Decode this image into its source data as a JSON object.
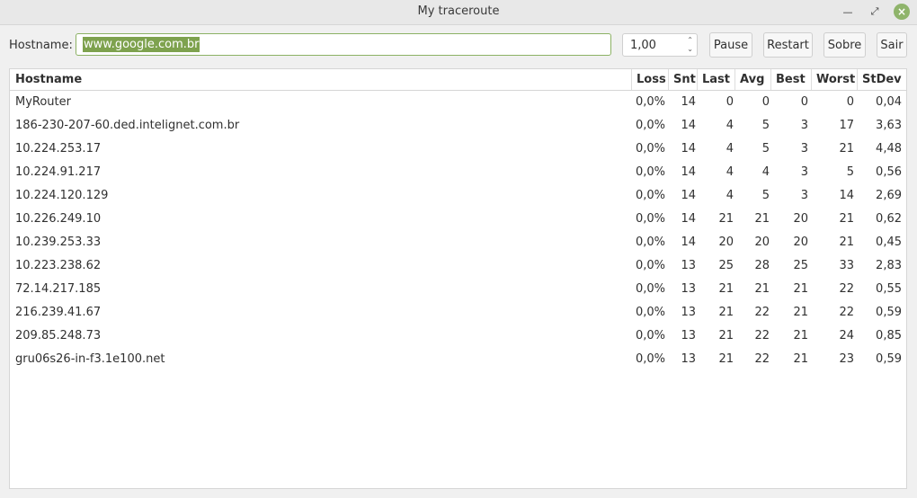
{
  "window": {
    "title": "My traceroute"
  },
  "toolbar": {
    "hostname_label": "Hostname:",
    "hostname_value": "www.google.com.br",
    "interval_value": "1,00",
    "pause_label": "Pause",
    "restart_label": "Restart",
    "sobre_label": "Sobre",
    "sair_label": "Sair"
  },
  "table": {
    "columns": [
      "Hostname",
      "Loss",
      "Snt",
      "Last",
      "Avg",
      "Best",
      "Worst",
      "StDev"
    ],
    "rows": [
      {
        "host": "MyRouter",
        "loss": "0,0%",
        "snt": "14",
        "last": "0",
        "avg": "0",
        "best": "0",
        "worst": "0",
        "stdev": "0,04"
      },
      {
        "host": "186-230-207-60.ded.intelignet.com.br",
        "loss": "0,0%",
        "snt": "14",
        "last": "4",
        "avg": "5",
        "best": "3",
        "worst": "17",
        "stdev": "3,63"
      },
      {
        "host": "10.224.253.17",
        "loss": "0,0%",
        "snt": "14",
        "last": "4",
        "avg": "5",
        "best": "3",
        "worst": "21",
        "stdev": "4,48"
      },
      {
        "host": "10.224.91.217",
        "loss": "0,0%",
        "snt": "14",
        "last": "4",
        "avg": "4",
        "best": "3",
        "worst": "5",
        "stdev": "0,56"
      },
      {
        "host": "10.224.120.129",
        "loss": "0,0%",
        "snt": "14",
        "last": "4",
        "avg": "5",
        "best": "3",
        "worst": "14",
        "stdev": "2,69"
      },
      {
        "host": "10.226.249.10",
        "loss": "0,0%",
        "snt": "14",
        "last": "21",
        "avg": "21",
        "best": "20",
        "worst": "21",
        "stdev": "0,62"
      },
      {
        "host": "10.239.253.33",
        "loss": "0,0%",
        "snt": "14",
        "last": "20",
        "avg": "20",
        "best": "20",
        "worst": "21",
        "stdev": "0,45"
      },
      {
        "host": "10.223.238.62",
        "loss": "0,0%",
        "snt": "13",
        "last": "25",
        "avg": "28",
        "best": "25",
        "worst": "33",
        "stdev": "2,83"
      },
      {
        "host": "72.14.217.185",
        "loss": "0,0%",
        "snt": "13",
        "last": "21",
        "avg": "21",
        "best": "21",
        "worst": "22",
        "stdev": "0,55"
      },
      {
        "host": "216.239.41.67",
        "loss": "0,0%",
        "snt": "13",
        "last": "21",
        "avg": "22",
        "best": "21",
        "worst": "22",
        "stdev": "0,59"
      },
      {
        "host": "209.85.248.73",
        "loss": "0,0%",
        "snt": "13",
        "last": "21",
        "avg": "22",
        "best": "21",
        "worst": "24",
        "stdev": "0,85"
      },
      {
        "host": "gru06s26-in-f3.1e100.net",
        "loss": "0,0%",
        "snt": "13",
        "last": "21",
        "avg": "22",
        "best": "21",
        "worst": "23",
        "stdev": "0,59"
      }
    ]
  }
}
